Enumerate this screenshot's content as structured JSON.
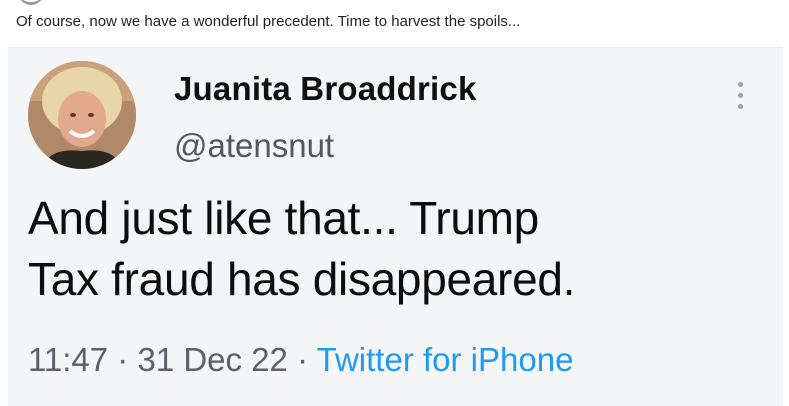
{
  "post": {
    "text": "Of course, now we have a wonderful precedent. Time to harvest the spoils..."
  },
  "tweet": {
    "display_name": "Juanita Broaddrick",
    "handle": "@atensnut",
    "body_lines": [
      "And just like that... Trump",
      "Tax fraud has disappeared."
    ],
    "time": "11:47",
    "separator": " · ",
    "date": "31 Dec 22",
    "source": "Twitter for iPhone",
    "source_color": "#1d9bf0",
    "more_icon": "vertical-ellipsis-icon"
  }
}
